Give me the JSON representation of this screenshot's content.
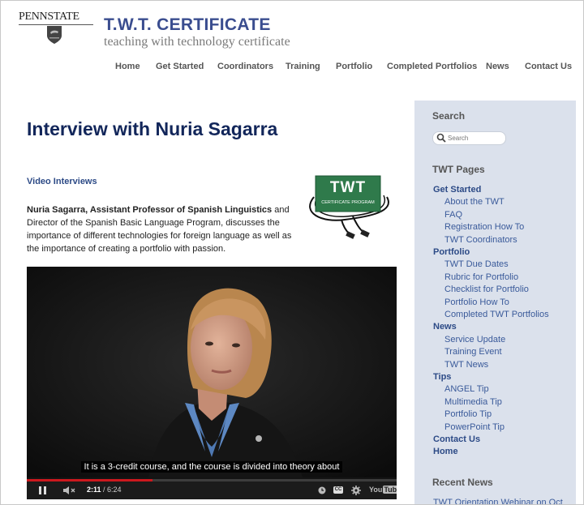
{
  "header": {
    "logo_text": "PENNSTATE",
    "site_title": "T.W.T. CERTIFICATE",
    "site_subtitle": "teaching with technology certificate"
  },
  "nav": [
    {
      "label": "Home"
    },
    {
      "label": "Get Started"
    },
    {
      "label": "Coordinators"
    },
    {
      "label": "Training"
    },
    {
      "label": "Portfolio"
    },
    {
      "label": "Completed Portfolios"
    },
    {
      "label": "News"
    },
    {
      "label": "Contact Us"
    }
  ],
  "main": {
    "title": "Interview with Nuria Sagarra",
    "section_link": "Video Interviews",
    "intro_bold": "Nuria Sagarra, Assistant Professor of Spanish Linguistics",
    "intro_rest": " and Director of the Spanish Basic Language Program, discusses the importance of different technologies for foreign language as well as the importance of creating a portfolio with passion.",
    "badge_title": "TWT",
    "badge_sub": "CERTIFICATE PROGRAM"
  },
  "video": {
    "caption": "It is a 3-credit course, and the course is divided into theory about",
    "current_time": "2:11",
    "duration": "/ 6:24",
    "progress": 0.341,
    "cc_label": "CC",
    "brand_you": "You",
    "brand_tube": "Tube"
  },
  "sidebar": {
    "search_heading": "Search",
    "search_placeholder": "Search",
    "pages_heading": "TWT Pages",
    "items": [
      {
        "label": "Get Started",
        "kind": "cat"
      },
      {
        "label": "About the TWT",
        "kind": "sub"
      },
      {
        "label": "FAQ",
        "kind": "sub"
      },
      {
        "label": "Registration How To",
        "kind": "sub"
      },
      {
        "label": "TWT Coordinators",
        "kind": "sub"
      },
      {
        "label": "Portfolio",
        "kind": "cat"
      },
      {
        "label": "TWT Due Dates",
        "kind": "sub"
      },
      {
        "label": "Rubric for Portfolio",
        "kind": "sub"
      },
      {
        "label": "Checklist for Portfolio",
        "kind": "sub"
      },
      {
        "label": "Portfolio How To",
        "kind": "sub"
      },
      {
        "label": "Completed TWT Portfolios",
        "kind": "sub"
      },
      {
        "label": "News",
        "kind": "cat"
      },
      {
        "label": "Service Update",
        "kind": "sub"
      },
      {
        "label": "Training Event",
        "kind": "sub"
      },
      {
        "label": "TWT News",
        "kind": "sub"
      },
      {
        "label": "Tips",
        "kind": "cat"
      },
      {
        "label": "ANGEL Tip",
        "kind": "sub"
      },
      {
        "label": "Multimedia Tip",
        "kind": "sub"
      },
      {
        "label": "Portfolio Tip",
        "kind": "sub"
      },
      {
        "label": "PowerPoint Tip",
        "kind": "sub"
      },
      {
        "label": "Contact Us",
        "kind": "cat"
      },
      {
        "label": "Home",
        "kind": "cat"
      }
    ],
    "recent_heading": "Recent News",
    "recent_items": [
      {
        "label": "TWT Orientation Webinar on Oct"
      }
    ]
  },
  "colors": {
    "title_blue": "#3a4d8f",
    "page_title": "#12265a",
    "link_blue": "#2c4a86",
    "sidebar_bg": "#dbe1ec",
    "badge_green": "#2f7a4b",
    "youtube_red": "#cc181e"
  }
}
